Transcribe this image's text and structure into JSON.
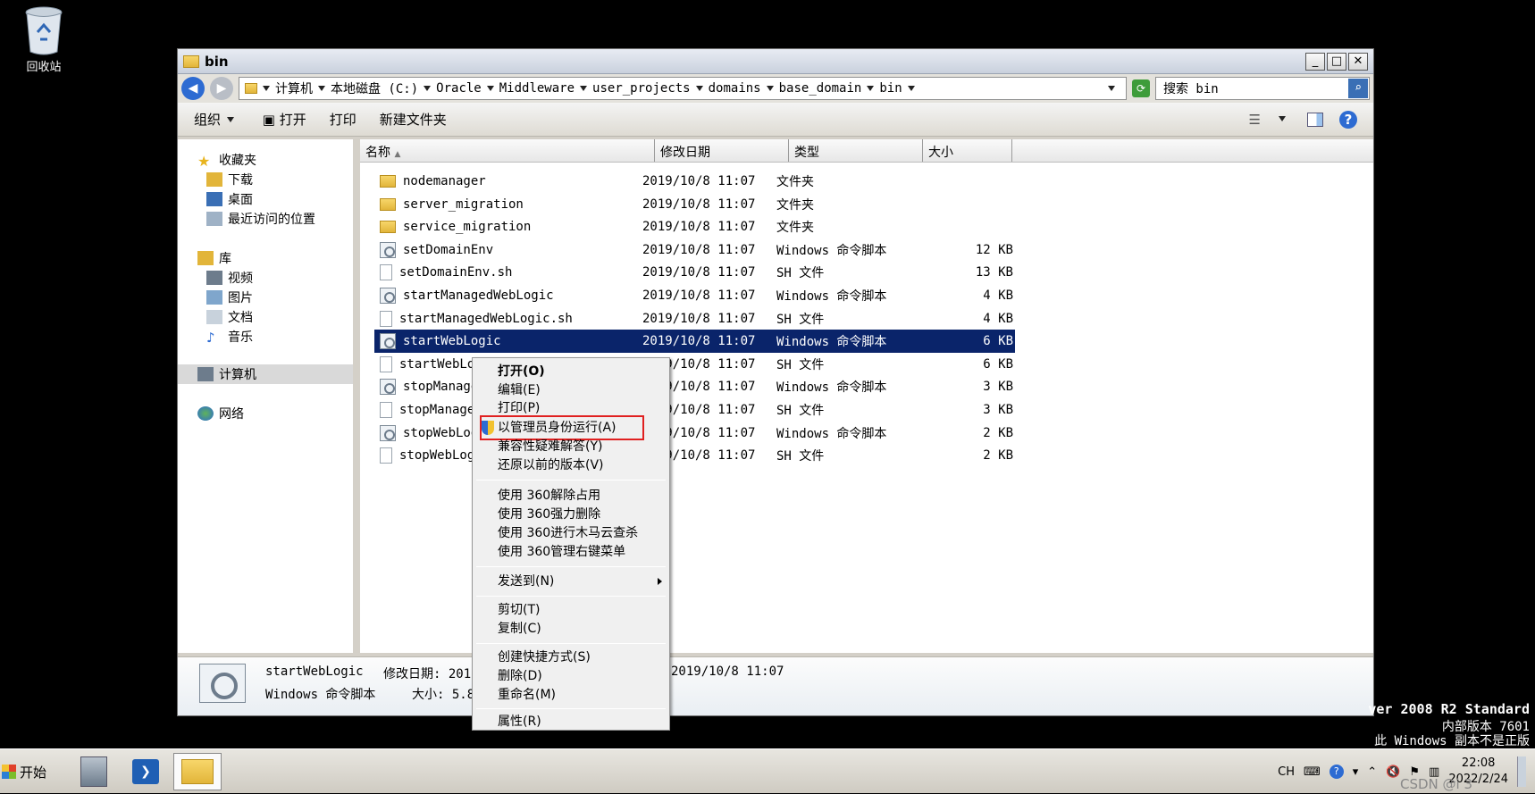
{
  "desktop": {
    "recycle_label": "回收站"
  },
  "window": {
    "title": "bin",
    "buttons": [
      "_",
      "□",
      "✕"
    ]
  },
  "address": {
    "crumbs": [
      "计算机",
      "本地磁盘 (C:)",
      "Oracle",
      "Middleware",
      "user_projects",
      "domains",
      "base_domain",
      "bin"
    ],
    "search_placeholder": "搜索 bin"
  },
  "toolbar": {
    "organize": "组织",
    "open": "打开",
    "print": "打印",
    "new_folder": "新建文件夹"
  },
  "nav": {
    "favorites": "收藏夹",
    "downloads": "下载",
    "desktop": "桌面",
    "recent": "最近访问的位置",
    "libraries": "库",
    "videos": "视频",
    "pictures": "图片",
    "documents": "文档",
    "music": "音乐",
    "computer": "计算机",
    "network": "网络"
  },
  "columns": {
    "name": "名称",
    "date": "修改日期",
    "type": "类型",
    "size": "大小"
  },
  "files": [
    {
      "name": "nodemanager",
      "date": "2019/10/8 11:07",
      "type": "文件夹",
      "size": "",
      "icon": "folder"
    },
    {
      "name": "server_migration",
      "date": "2019/10/8 11:07",
      "type": "文件夹",
      "size": "",
      "icon": "folder"
    },
    {
      "name": "service_migration",
      "date": "2019/10/8 11:07",
      "type": "文件夹",
      "size": "",
      "icon": "folder"
    },
    {
      "name": "setDomainEnv",
      "date": "2019/10/8 11:07",
      "type": "Windows 命令脚本",
      "size": "12 KB",
      "icon": "cmd"
    },
    {
      "name": "setDomainEnv.sh",
      "date": "2019/10/8 11:07",
      "type": "SH 文件",
      "size": "13 KB",
      "icon": "doc"
    },
    {
      "name": "startManagedWebLogic",
      "date": "2019/10/8 11:07",
      "type": "Windows 命令脚本",
      "size": "4 KB",
      "icon": "cmd"
    },
    {
      "name": "startManagedWebLogic.sh",
      "date": "2019/10/8 11:07",
      "type": "SH 文件",
      "size": "4 KB",
      "icon": "doc"
    },
    {
      "name": "startWebLogic",
      "date": "2019/10/8 11:07",
      "type": "Windows 命令脚本",
      "size": "6 KB",
      "icon": "cmd",
      "selected": true
    },
    {
      "name": "startWebLo",
      "date": "2019/10/8 11:07",
      "type": "SH 文件",
      "size": "6 KB",
      "icon": "doc"
    },
    {
      "name": "stopManage",
      "date": "2019/10/8 11:07",
      "type": "Windows 命令脚本",
      "size": "3 KB",
      "icon": "cmd"
    },
    {
      "name": "stopManage",
      "date": "2019/10/8 11:07",
      "type": "SH 文件",
      "size": "3 KB",
      "icon": "doc"
    },
    {
      "name": "stopWebLog",
      "date": "2019/10/8 11:07",
      "type": "Windows 命令脚本",
      "size": "2 KB",
      "icon": "cmd"
    },
    {
      "name": "stopWebLog",
      "date": "2019/10/8 11:07",
      "type": "SH 文件",
      "size": "2 KB",
      "icon": "doc"
    }
  ],
  "details": {
    "name": "startWebLogic",
    "modified_label": "修改日期: 2019",
    "modified_value": "2019/10/8 11:07",
    "type": "Windows 命令脚本",
    "size_label": "大小: 5.80"
  },
  "context_menu": {
    "open": "打开(O)",
    "edit": "编辑(E)",
    "print": "打印(P)",
    "run_as_admin": "以管理员身份运行(A)",
    "troubleshoot": "兼容性疑难解答(Y)",
    "restore": "还原以前的版本(V)",
    "unlock360": "使用 360解除占用",
    "delete360": "使用 360强力删除",
    "scan360": "使用 360进行木马云查杀",
    "manage360": "使用 360管理右键菜单",
    "send_to": "发送到(N)",
    "cut": "剪切(T)",
    "copy": "复制(C)",
    "shortcut": "创建快捷方式(S)",
    "delete": "删除(D)",
    "rename": "重命名(M)",
    "properties": "属性(R)"
  },
  "os_watermark": {
    "line1": "ver 2008 R2 Standard",
    "line2": "内部版本 7601",
    "line3": "此 Windows 副本不是正版"
  },
  "taskbar": {
    "start": "开始",
    "lang": "CH",
    "time": "22:08",
    "date": "2022/2/24",
    "watermark": "CSDN @i 3"
  }
}
